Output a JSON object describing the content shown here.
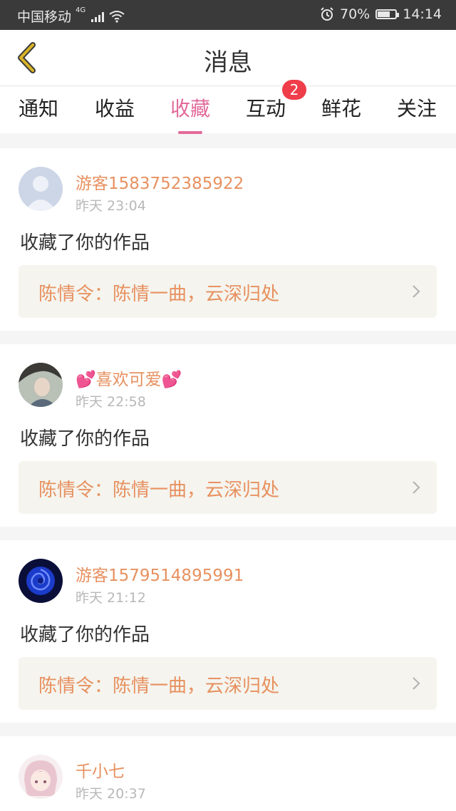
{
  "status_bar": {
    "carrier": "中国移动",
    "network": "4G",
    "battery": "70%",
    "battery_level": 0.7,
    "time": "14:14"
  },
  "header": {
    "title": "消息"
  },
  "tabs": [
    {
      "label": "通知"
    },
    {
      "label": "收益"
    },
    {
      "label": "收藏",
      "active": true
    },
    {
      "label": "互动",
      "badge": "2"
    },
    {
      "label": "鲜花"
    },
    {
      "label": "关注"
    }
  ],
  "messages": [
    {
      "user": "游客1583752385922",
      "time": "昨天 23:04",
      "action": "收藏了你的作品",
      "work": "陈情令：陈情一曲，云深归处"
    },
    {
      "user": "💕喜欢可爱💕",
      "time": "昨天 22:58",
      "action": "收藏了你的作品",
      "work": "陈情令：陈情一曲，云深归处"
    },
    {
      "user": "游客1579514895991",
      "time": "昨天 21:12",
      "action": "收藏了你的作品",
      "work": "陈情令：陈情一曲，云深归处"
    },
    {
      "user": "千小七",
      "time": "昨天 20:37"
    }
  ],
  "colors": {
    "accent": "#e36a9b",
    "username": "#e79160",
    "badge": "#ef3d4a",
    "back_icon": "#d9b326"
  }
}
